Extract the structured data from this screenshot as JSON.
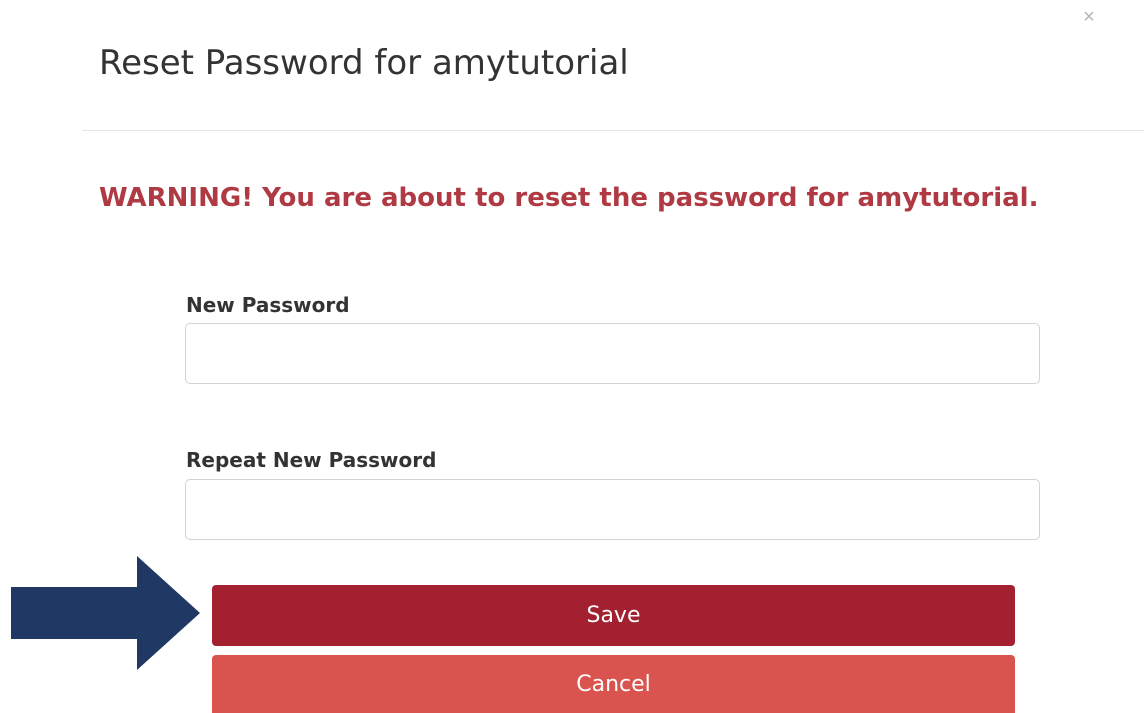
{
  "dialog": {
    "title": "Reset Password for amytutorial",
    "close_glyph": "×",
    "warning": "WARNING! You are about to reset the password for amytutorial."
  },
  "form": {
    "new_password": {
      "label": "New Password",
      "value": "",
      "placeholder": ""
    },
    "repeat_password": {
      "label": "Repeat New Password",
      "value": "",
      "placeholder": ""
    }
  },
  "buttons": {
    "save_label": "Save",
    "cancel_label": "Cancel"
  },
  "annotation": {
    "arrow_icon": "right-arrow-icon",
    "arrow_color": "#1f3864"
  },
  "colors": {
    "warning": "#b03a43",
    "save_button": "#a32030",
    "cancel_button": "#d9534f"
  }
}
